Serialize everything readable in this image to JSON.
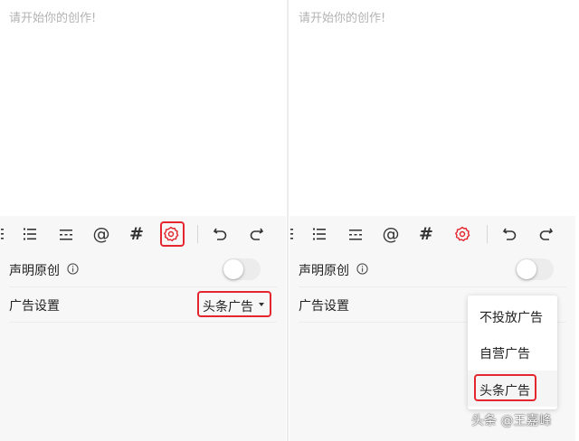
{
  "editor": {
    "placeholder": "请开始你的创作!"
  },
  "toolbar": {
    "icons": [
      "list-icon",
      "ordered-list-icon",
      "divider-icon",
      "mention-icon",
      "hashtag-icon",
      "settings-icon",
      "undo-icon",
      "redo-icon"
    ],
    "mention": "@",
    "hashtag": "#",
    "active_color": "#e4272f"
  },
  "settings": {
    "original_label": "声明原创",
    "original_toggle": "off",
    "ad_label": "广告设置",
    "ad_selected": "头条广告"
  },
  "dropdown": {
    "options": [
      "不投放广告",
      "自营广告",
      "头条广告"
    ],
    "selected": "头条广告"
  },
  "watermark": "头条 @王嘉峰",
  "colors": {
    "highlight": "#e4272f",
    "panel_bg": "#f7f7f7",
    "placeholder": "#b3b3b3"
  }
}
